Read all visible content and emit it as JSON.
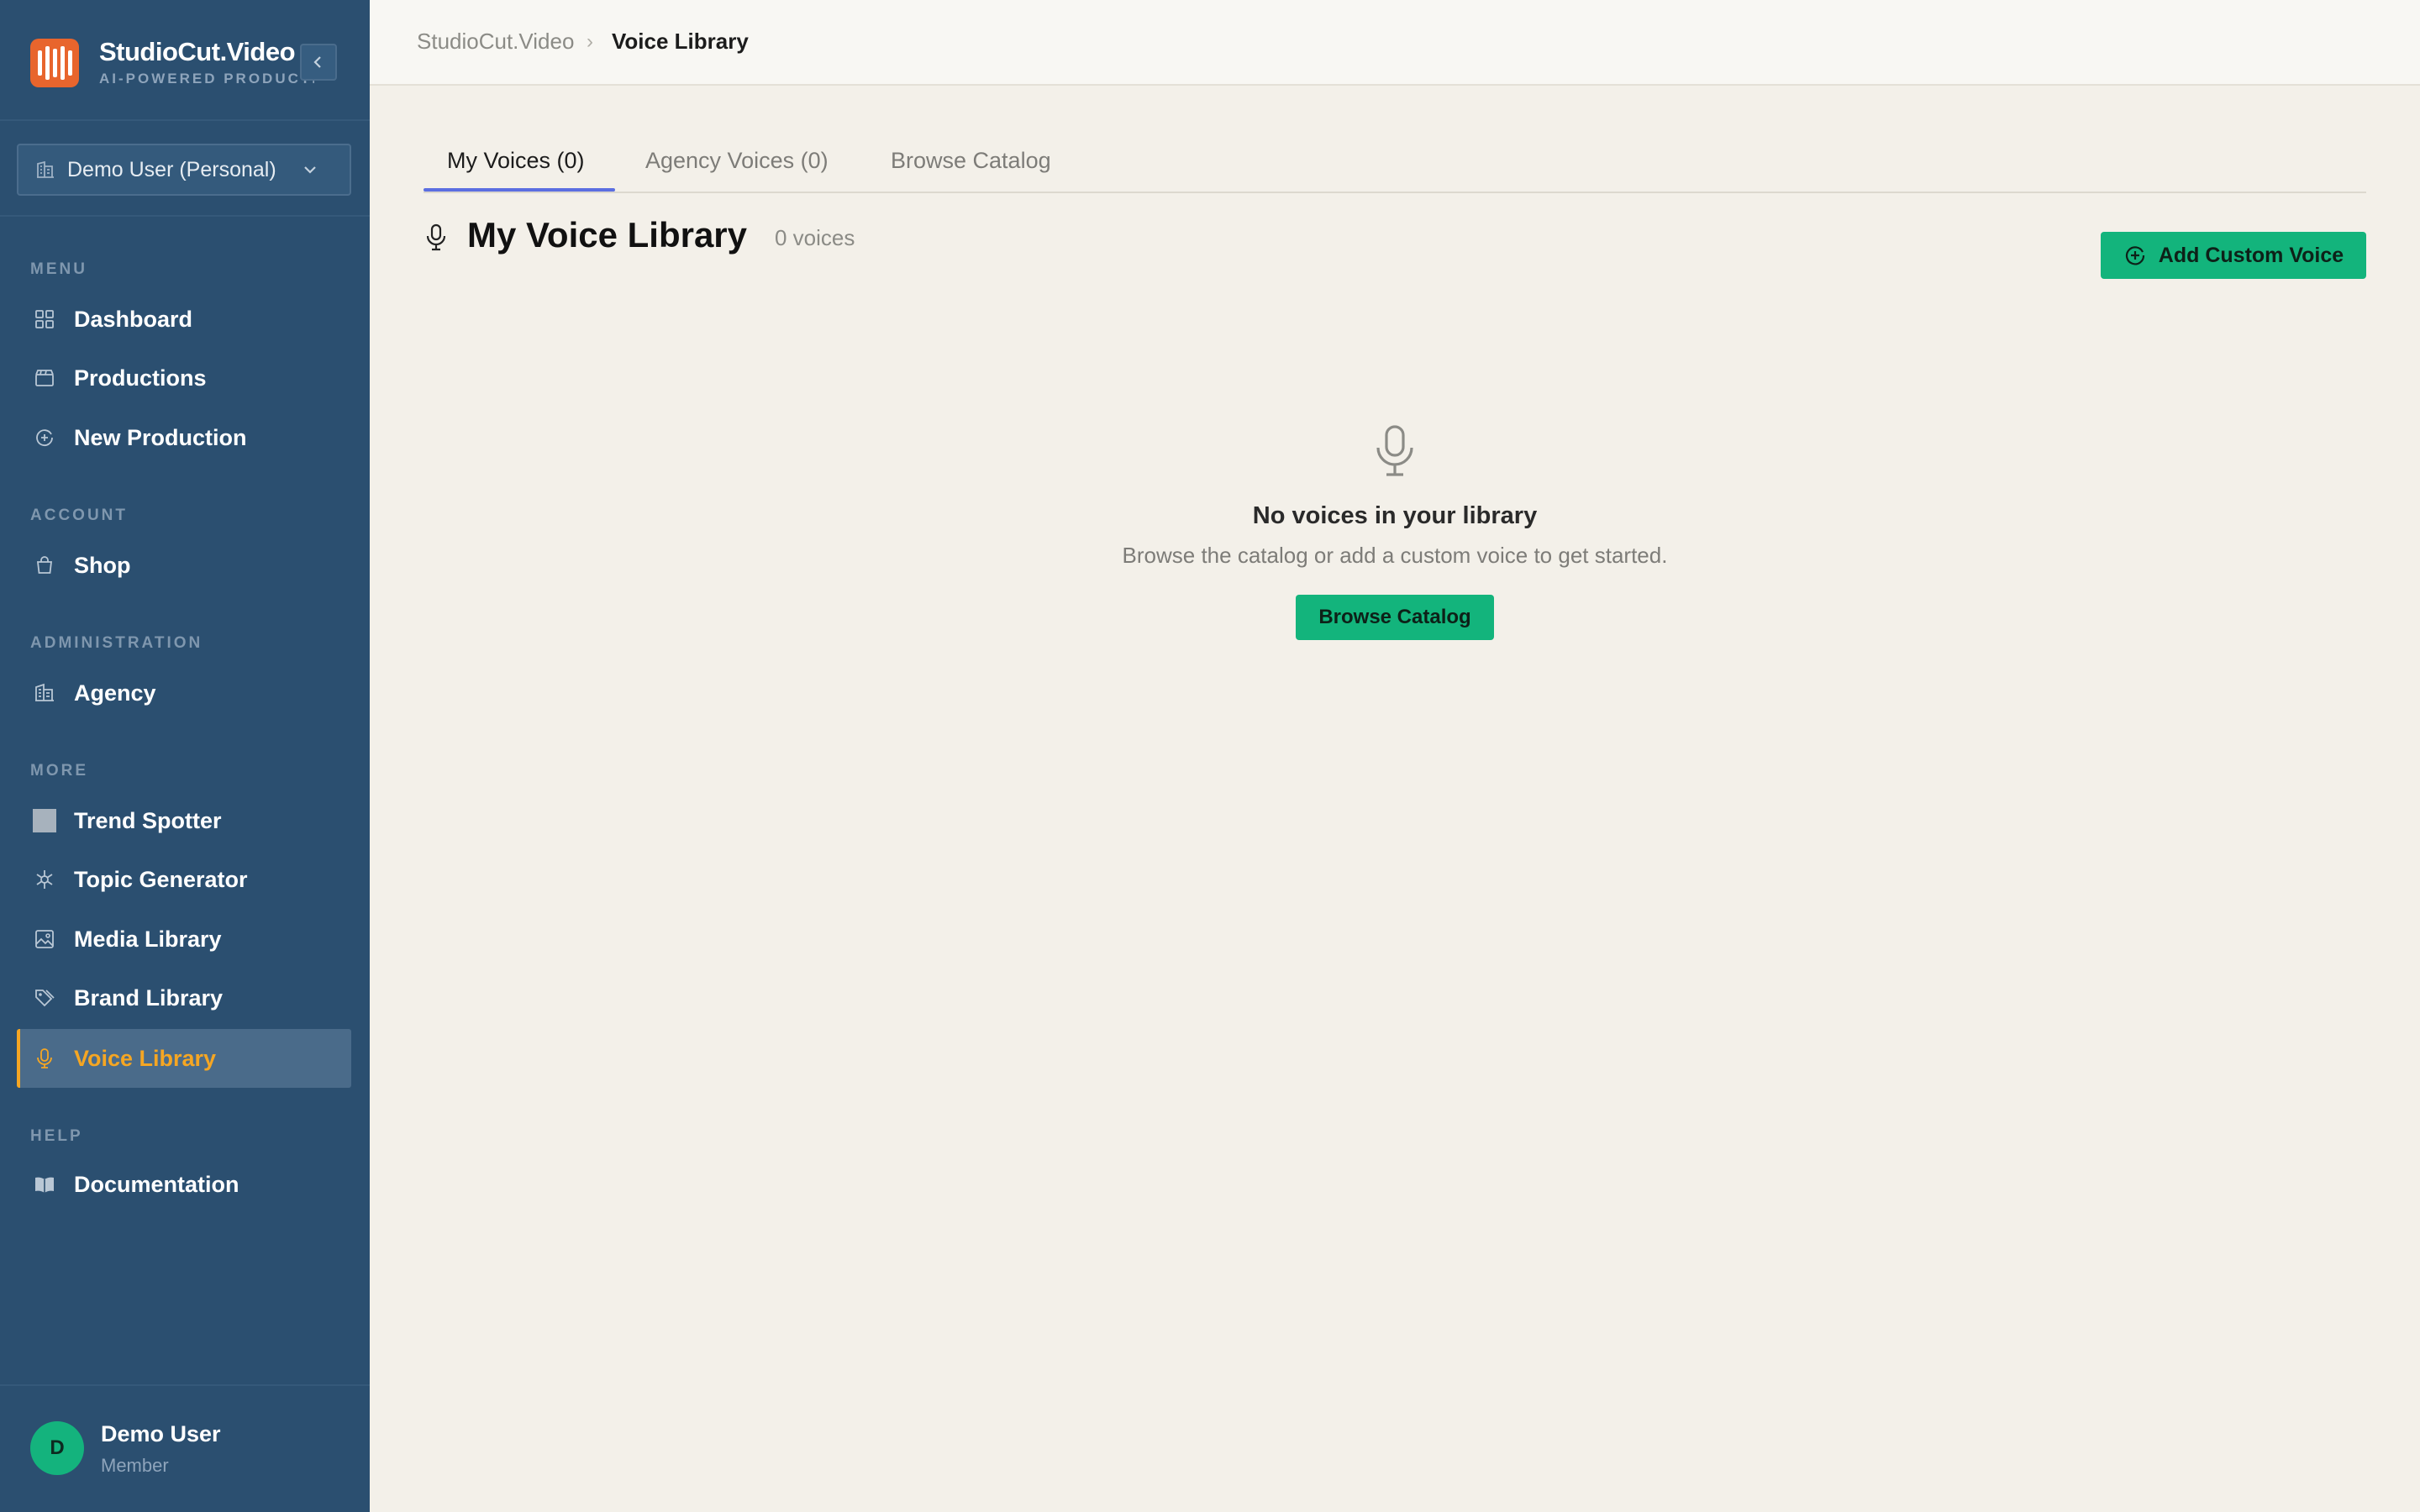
{
  "app": {
    "name": "StudioCut.Video",
    "tagline": "AI-POWERED PRODUCTION",
    "brand_color": "#e8652d"
  },
  "account_switcher": {
    "label": "Demo User (Personal)"
  },
  "sidebar": {
    "sections": [
      {
        "label": "MENU",
        "items": [
          {
            "label": "Dashboard",
            "icon": "grid-icon"
          },
          {
            "label": "Productions",
            "icon": "clapperboard-icon"
          },
          {
            "label": "New Production",
            "icon": "plus-circle-icon"
          }
        ]
      },
      {
        "label": "ACCOUNT",
        "items": [
          {
            "label": "Shop",
            "icon": "shopping-bag-icon"
          }
        ]
      },
      {
        "label": "ADMINISTRATION",
        "items": [
          {
            "label": "Agency",
            "icon": "building-icon"
          }
        ]
      },
      {
        "label": "MORE",
        "items": [
          {
            "label": "Trend Spotter",
            "icon": "square-icon"
          },
          {
            "label": "Topic Generator",
            "icon": "sparkle-icon"
          },
          {
            "label": "Media Library",
            "icon": "image-icon"
          },
          {
            "label": "Brand Library",
            "icon": "tags-icon"
          },
          {
            "label": "Voice Library",
            "icon": "microphone-icon",
            "active": true
          }
        ]
      },
      {
        "label": "HELP",
        "items": [
          {
            "label": "Documentation",
            "icon": "book-icon"
          }
        ]
      }
    ],
    "active_color": "#f5a623"
  },
  "user": {
    "initial": "D",
    "name": "Demo User",
    "role": "Member"
  },
  "breadcrumb": {
    "root": "StudioCut.Video",
    "separator": "›",
    "current": "Voice Library"
  },
  "tabs": [
    {
      "label": "My Voices (0)",
      "active": true
    },
    {
      "label": "Agency Voices (0)"
    },
    {
      "label": "Browse Catalog"
    }
  ],
  "library": {
    "title": "My Voice Library",
    "count": "0 voices",
    "add_button": "Add Custom Voice"
  },
  "empty_state": {
    "title": "No voices in your library",
    "subtitle": "Browse the catalog or add a custom voice to get started.",
    "button": "Browse Catalog"
  },
  "colors": {
    "accent_green": "#13b47c",
    "tab_indicator": "#5b6ee1",
    "sidebar_bg": "#2b4f70"
  }
}
